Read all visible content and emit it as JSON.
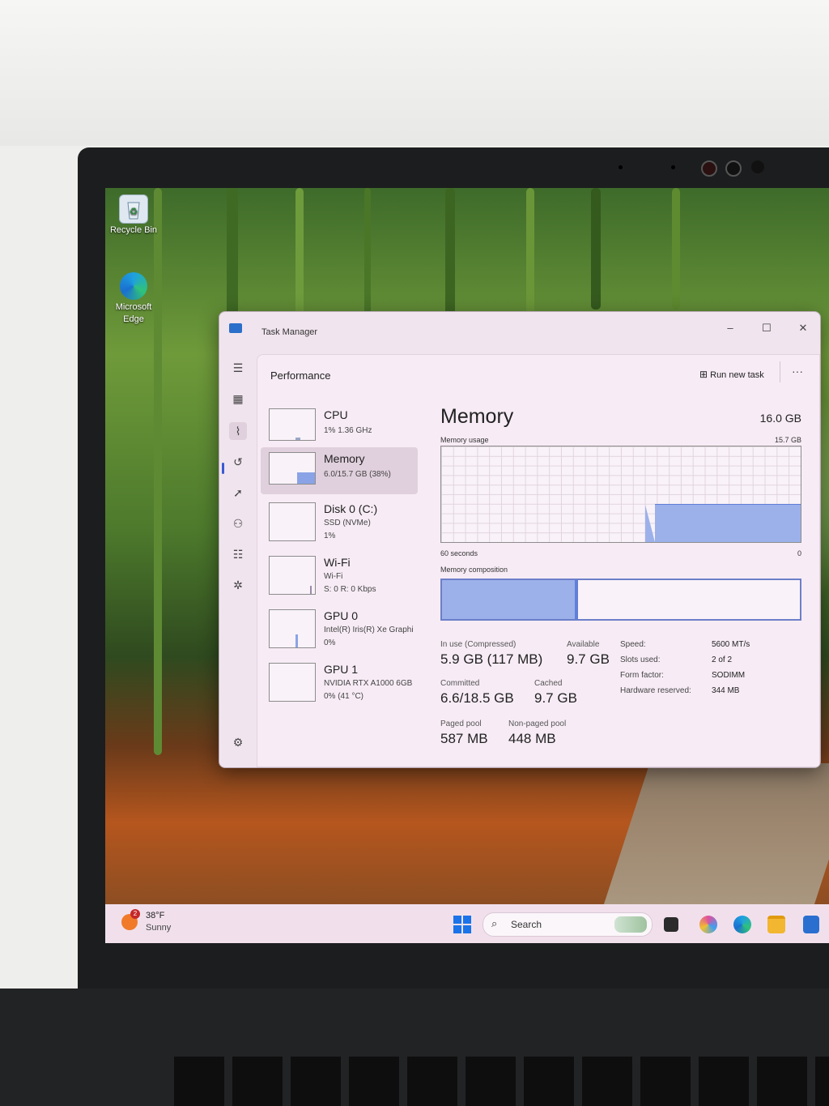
{
  "desktop": {
    "icons": [
      {
        "label": "Recycle Bin"
      },
      {
        "label": "Microsoft\nEdge"
      }
    ]
  },
  "task_manager": {
    "title": "Task Manager",
    "window_controls": {
      "minimize": "–",
      "maximize": "☐",
      "close": "✕"
    },
    "section": "Performance",
    "run_new_task": "Run new task",
    "more": "···",
    "sidebar": [
      {
        "name": "CPU",
        "line1": "1%  1.36 GHz",
        "line2": ""
      },
      {
        "name": "Memory",
        "line1": "6.0/15.7 GB (38%)",
        "line2": ""
      },
      {
        "name": "Disk 0 (C:)",
        "line1": "SSD (NVMe)",
        "line2": "1%"
      },
      {
        "name": "Wi-Fi",
        "line1": "Wi-Fi",
        "line2": "S: 0  R: 0 Kbps"
      },
      {
        "name": "GPU 0",
        "line1": "Intel(R) Iris(R) Xe Graphi",
        "line2": "0%"
      },
      {
        "name": "GPU 1",
        "line1": "NVIDIA RTX A1000 6GB",
        "line2": "0% (41 °C)"
      }
    ],
    "memory": {
      "heading": "Memory",
      "total": "16.0 GB",
      "usage_label": "Memory usage",
      "usage_max": "15.7 GB",
      "seconds_label": "60 seconds",
      "zero_label": "0",
      "composition_label": "Memory composition",
      "usage_fraction": 0.38,
      "stats": {
        "in_use_label": "In use (Compressed)",
        "in_use_value": "5.9 GB (117 MB)",
        "available_label": "Available",
        "available_value": "9.7 GB",
        "committed_label": "Committed",
        "committed_value": "6.6/18.5 GB",
        "cached_label": "Cached",
        "cached_value": "9.7 GB",
        "paged_label": "Paged pool",
        "paged_value": "587 MB",
        "nonpaged_label": "Non-paged pool",
        "nonpaged_value": "448 MB"
      },
      "properties": [
        {
          "label": "Speed:",
          "value": "5600 MT/s"
        },
        {
          "label": "Slots used:",
          "value": "2 of 2"
        },
        {
          "label": "Form factor:",
          "value": "SODIMM"
        },
        {
          "label": "Hardware reserved:",
          "value": "344 MB"
        }
      ]
    }
  },
  "taskbar": {
    "weather_temp": "38°F",
    "weather_desc": "Sunny",
    "weather_badge": "2",
    "search_placeholder": "Search"
  }
}
